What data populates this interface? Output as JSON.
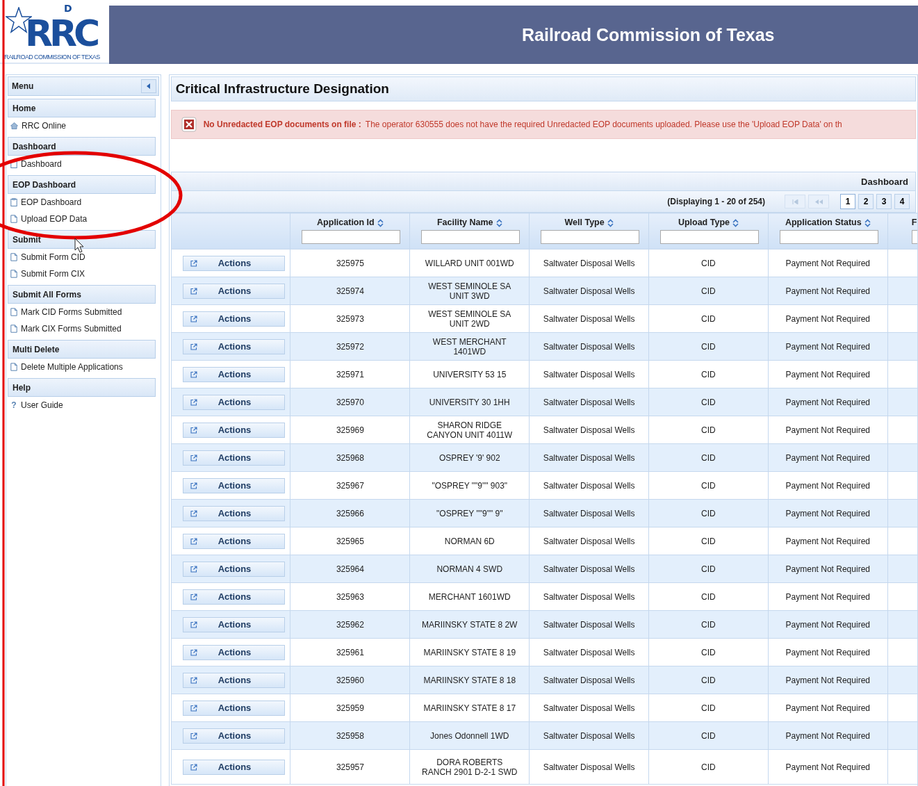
{
  "header": {
    "logo_letters": "RRC",
    "logo_mark": "D",
    "logo_caption": "RAILROAD COMMISSION OF TEXAS",
    "title": "Railroad Commission of Texas"
  },
  "sidebar": {
    "title": "Menu",
    "sections": [
      {
        "heading": "Home",
        "items": [
          {
            "label": "RRC Online",
            "kind": "home"
          }
        ]
      },
      {
        "heading": "Dashboard",
        "items": [
          {
            "label": "Dashboard",
            "kind": "clipboard"
          }
        ]
      },
      {
        "heading": "EOP Dashboard",
        "items": [
          {
            "label": "EOP Dashboard",
            "kind": "clipboard"
          },
          {
            "label": "Upload EOP Data",
            "kind": "document"
          }
        ]
      },
      {
        "heading": "Submit",
        "items": [
          {
            "label": "Submit Form CID",
            "kind": "document"
          },
          {
            "label": "Submit Form CIX",
            "kind": "document"
          }
        ]
      },
      {
        "heading": "Submit All Forms",
        "items": [
          {
            "label": "Mark CID Forms Submitted",
            "kind": "document"
          },
          {
            "label": "Mark CIX Forms Submitted",
            "kind": "document"
          }
        ]
      },
      {
        "heading": "Multi Delete",
        "items": [
          {
            "label": "Delete Multiple Applications",
            "kind": "document"
          }
        ]
      },
      {
        "heading": "Help",
        "items": [
          {
            "label": "User Guide",
            "kind": "help",
            "glyph": "?"
          }
        ]
      }
    ]
  },
  "page_title": "Critical Infrastructure Designation",
  "alert": {
    "title": "No Unredacted EOP documents on file :",
    "message": "The operator 630555 does not have the required Unredacted EOP documents uploaded. Please use the 'Upload EOP Data' on th"
  },
  "grid": {
    "caption": "Dashboard",
    "display_info": "(Displaying 1 - 20 of 254)",
    "pages": [
      {
        "label": "1",
        "selected": true
      },
      {
        "label": "2",
        "selected": false
      },
      {
        "label": "3",
        "selected": false
      },
      {
        "label": "4",
        "selected": false
      }
    ],
    "columns": [
      "Application Id",
      "Facility Name",
      "Well Type",
      "Upload Type",
      "Application Status",
      "F"
    ],
    "rows": [
      {
        "action": "Actions",
        "id": "325975",
        "facility": "WILLARD UNIT 001WD",
        "well_type": "Saltwater Disposal Wells",
        "upload_type": "CID",
        "status": "Payment Not Required"
      },
      {
        "action": "Actions",
        "id": "325974",
        "facility": "WEST SEMINOLE SA UNIT 3WD",
        "well_type": "Saltwater Disposal Wells",
        "upload_type": "CID",
        "status": "Payment Not Required"
      },
      {
        "action": "Actions",
        "id": "325973",
        "facility": "WEST SEMINOLE SA UNIT 2WD",
        "well_type": "Saltwater Disposal Wells",
        "upload_type": "CID",
        "status": "Payment Not Required"
      },
      {
        "action": "Actions",
        "id": "325972",
        "facility": "WEST MERCHANT 1401WD",
        "well_type": "Saltwater Disposal Wells",
        "upload_type": "CID",
        "status": "Payment Not Required"
      },
      {
        "action": "Actions",
        "id": "325971",
        "facility": "UNIVERSITY 53 15",
        "well_type": "Saltwater Disposal Wells",
        "upload_type": "CID",
        "status": "Payment Not Required"
      },
      {
        "action": "Actions",
        "id": "325970",
        "facility": "UNIVERSITY 30 1HH",
        "well_type": "Saltwater Disposal Wells",
        "upload_type": "CID",
        "status": "Payment Not Required"
      },
      {
        "action": "Actions",
        "id": "325969",
        "facility": "SHARON RIDGE CANYON UNIT 4011W",
        "well_type": "Saltwater Disposal Wells",
        "upload_type": "CID",
        "status": "Payment Not Required"
      },
      {
        "action": "Actions",
        "id": "325968",
        "facility": "OSPREY '9' 902",
        "well_type": "Saltwater Disposal Wells",
        "upload_type": "CID",
        "status": "Payment Not Required"
      },
      {
        "action": "Actions",
        "id": "325967",
        "facility": "\"OSPREY \"\"9\"\" 903\"",
        "well_type": "Saltwater Disposal Wells",
        "upload_type": "CID",
        "status": "Payment Not Required"
      },
      {
        "action": "Actions",
        "id": "325966",
        "facility": "\"OSPREY \"\"9\"\" 9\"",
        "well_type": "Saltwater Disposal Wells",
        "upload_type": "CID",
        "status": "Payment Not Required"
      },
      {
        "action": "Actions",
        "id": "325965",
        "facility": "NORMAN 6D",
        "well_type": "Saltwater Disposal Wells",
        "upload_type": "CID",
        "status": "Payment Not Required"
      },
      {
        "action": "Actions",
        "id": "325964",
        "facility": "NORMAN 4 SWD",
        "well_type": "Saltwater Disposal Wells",
        "upload_type": "CID",
        "status": "Payment Not Required"
      },
      {
        "action": "Actions",
        "id": "325963",
        "facility": "MERCHANT 1601WD",
        "well_type": "Saltwater Disposal Wells",
        "upload_type": "CID",
        "status": "Payment Not Required"
      },
      {
        "action": "Actions",
        "id": "325962",
        "facility": "MARIINSKY STATE 8 2W",
        "well_type": "Saltwater Disposal Wells",
        "upload_type": "CID",
        "status": "Payment Not Required"
      },
      {
        "action": "Actions",
        "id": "325961",
        "facility": "MARIINSKY STATE 8 19",
        "well_type": "Saltwater Disposal Wells",
        "upload_type": "CID",
        "status": "Payment Not Required"
      },
      {
        "action": "Actions",
        "id": "325960",
        "facility": "MARIINSKY STATE 8 18",
        "well_type": "Saltwater Disposal Wells",
        "upload_type": "CID",
        "status": "Payment Not Required"
      },
      {
        "action": "Actions",
        "id": "325959",
        "facility": "MARIINSKY STATE 8 17",
        "well_type": "Saltwater Disposal Wells",
        "upload_type": "CID",
        "status": "Payment Not Required"
      },
      {
        "action": "Actions",
        "id": "325958",
        "facility": "Jones Odonnell 1WD",
        "well_type": "Saltwater Disposal Wells",
        "upload_type": "CID",
        "status": "Payment Not Required"
      },
      {
        "action": "Actions",
        "id": "325957",
        "facility": "DORA ROBERTS RANCH 2901 D-2-1 SWD",
        "well_type": "Saltwater Disposal Wells",
        "upload_type": "CID",
        "status": "Payment Not Required"
      }
    ]
  }
}
